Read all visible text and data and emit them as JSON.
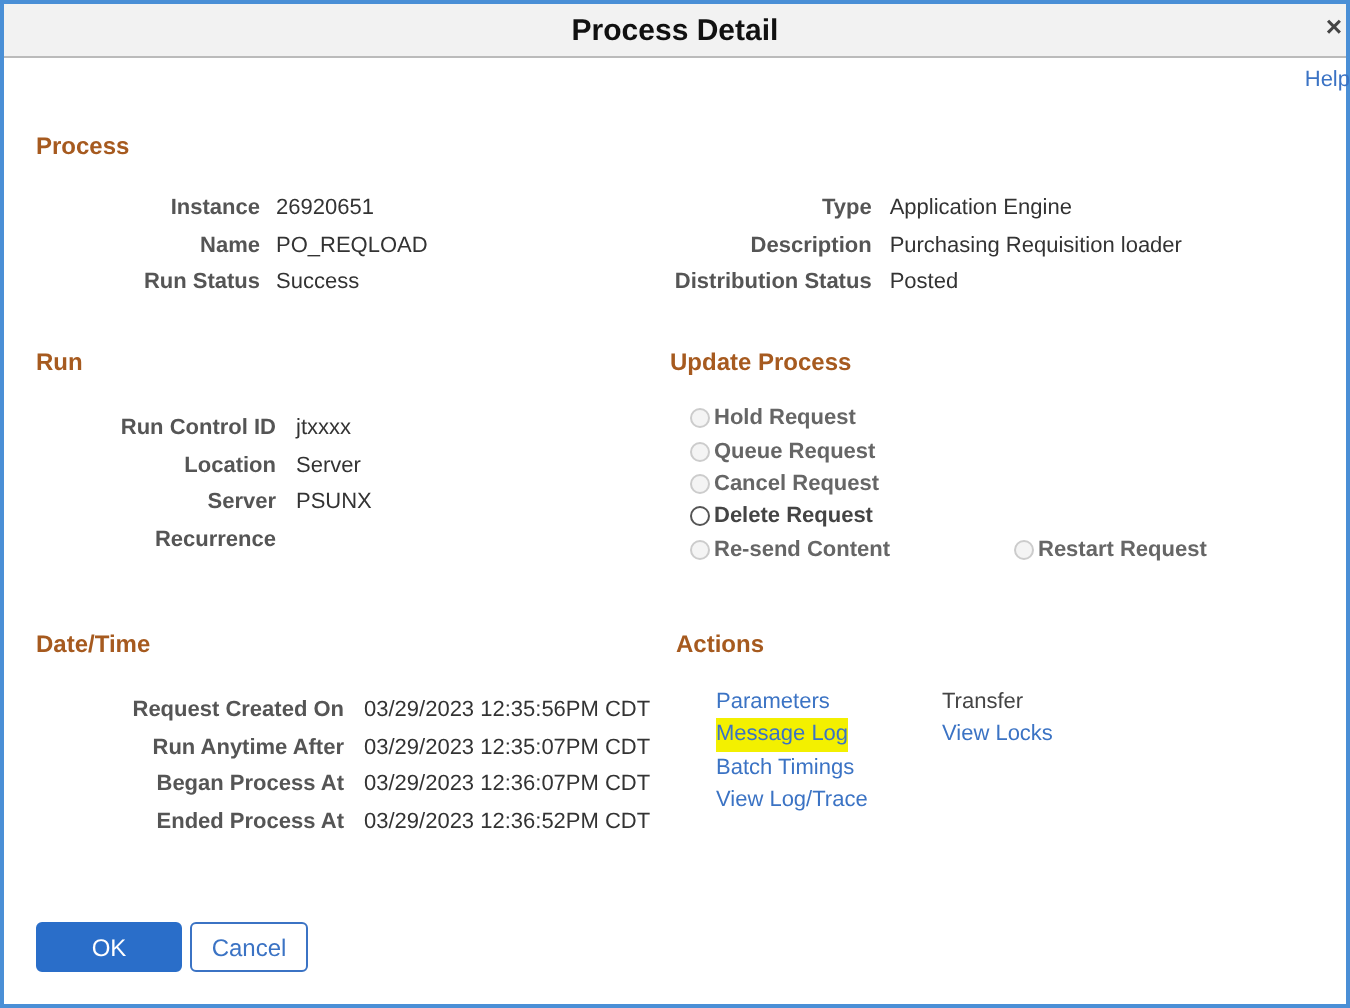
{
  "window": {
    "title": "Process Detail",
    "close": "×"
  },
  "help": "Help",
  "process": {
    "heading": "Process",
    "left": [
      {
        "label": "Instance",
        "value": "26920651"
      },
      {
        "label": "Name",
        "value": "PO_REQLOAD"
      },
      {
        "label": "Run Status",
        "value": "Success"
      }
    ],
    "right": [
      {
        "label": "Type",
        "value": "Application Engine"
      },
      {
        "label": "Description",
        "value": "Purchasing Requisition loader"
      },
      {
        "label": "Distribution Status",
        "value": "Posted"
      }
    ]
  },
  "run": {
    "heading": "Run",
    "fields": [
      {
        "label": "Run Control ID",
        "value": "jtxxxx"
      },
      {
        "label": "Location",
        "value": "Server"
      },
      {
        "label": "Server",
        "value": "PSUNX"
      },
      {
        "label": "Recurrence"
      }
    ]
  },
  "update_process": {
    "heading": "Update Process",
    "options": [
      {
        "label": "Hold Request",
        "disabled": true,
        "selected": false
      },
      {
        "label": "Queue Request",
        "disabled": true,
        "selected": false
      },
      {
        "label": "Cancel Request",
        "disabled": true,
        "selected": false
      },
      {
        "label": "Delete Request",
        "disabled": false,
        "selected": false
      },
      {
        "label": "Re-send Content",
        "disabled": true,
        "selected": false
      },
      {
        "label": "Restart Request",
        "disabled": true,
        "selected": false
      }
    ]
  },
  "date_time": {
    "heading": "Date/Time",
    "fields": [
      {
        "label": "Request Created On",
        "value": "03/29/2023 12:35:56PM CDT"
      },
      {
        "label": "Run Anytime After",
        "value": "03/29/2023 12:35:07PM CDT"
      },
      {
        "label": "Began Process At",
        "value": "03/29/2023 12:36:07PM CDT"
      },
      {
        "label": "Ended Process At",
        "value": "03/29/2023 12:36:52PM CDT"
      }
    ]
  },
  "actions": {
    "heading": "Actions",
    "columns": [
      [
        {
          "label": "Parameters",
          "disabled": false,
          "highlighted": false
        },
        {
          "label": "Message Log",
          "disabled": false,
          "highlighted": true
        },
        {
          "label": "Batch Timings",
          "disabled": false,
          "highlighted": false
        },
        {
          "label": "View Log/Trace",
          "disabled": false,
          "highlighted": false
        }
      ],
      [
        {
          "label": "Transfer",
          "disabled": true,
          "highlighted": false
        },
        {
          "label": "View Locks",
          "disabled": false,
          "highlighted": false
        }
      ]
    ]
  },
  "buttons": {
    "ok": "OK",
    "cancel": "Cancel"
  }
}
